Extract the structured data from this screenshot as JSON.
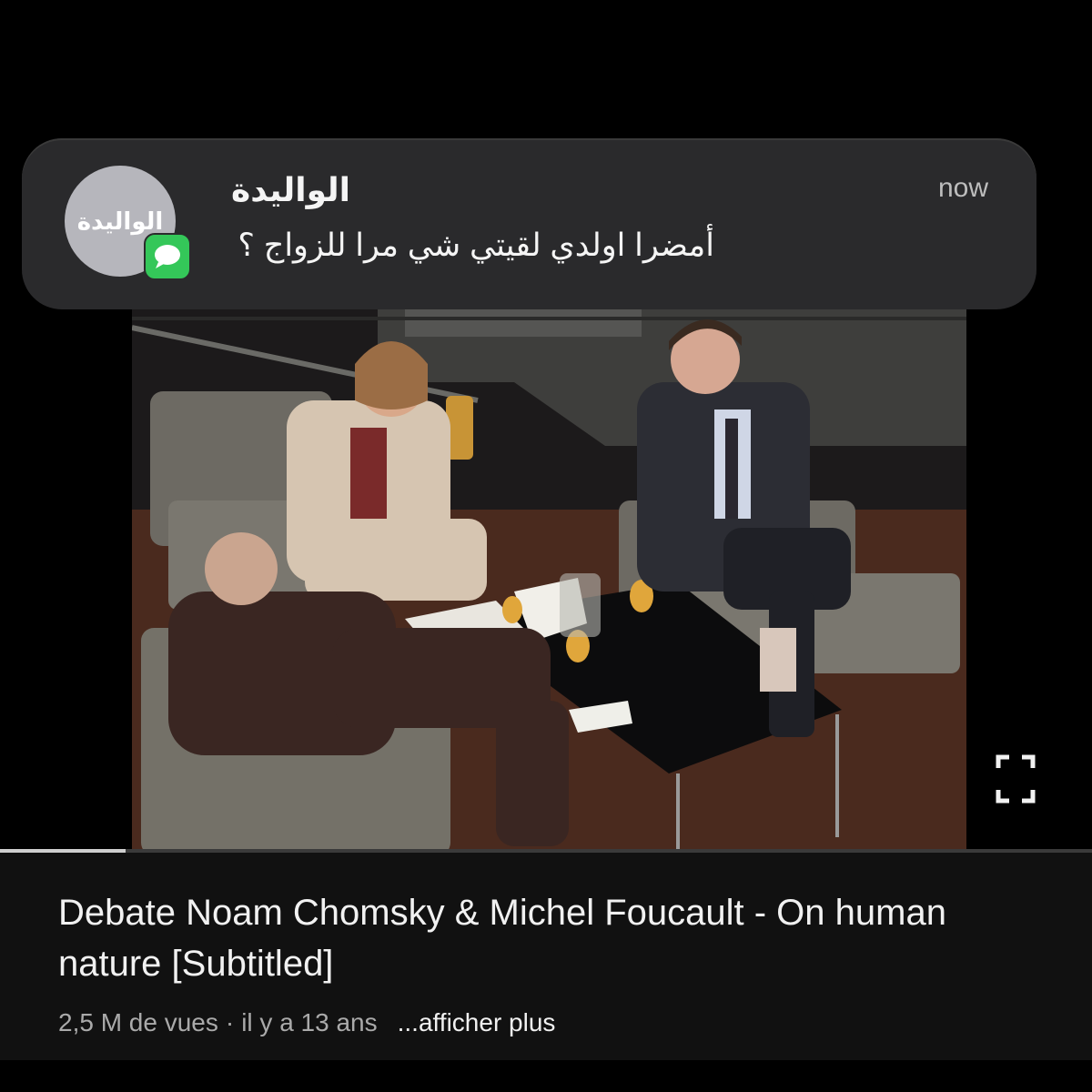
{
  "notification": {
    "avatar_text": "الواليدة",
    "sender": "الواليدة",
    "message": "أمضرا اولدي لقيتي شي مرا للزواج ؟",
    "time": "now",
    "app_icon": "messages-icon"
  },
  "video": {
    "title": "Debate Noam Chomsky & Michel Foucault - On human nature [Subtitled]",
    "views": "2,5 M de vues",
    "separator": "·",
    "age": "il y a 13 ans",
    "more_label": "...afficher plus",
    "progress_fraction": 0.115
  },
  "colors": {
    "message_badge": "#34c759",
    "notification_bg": "#2a2a2c"
  }
}
